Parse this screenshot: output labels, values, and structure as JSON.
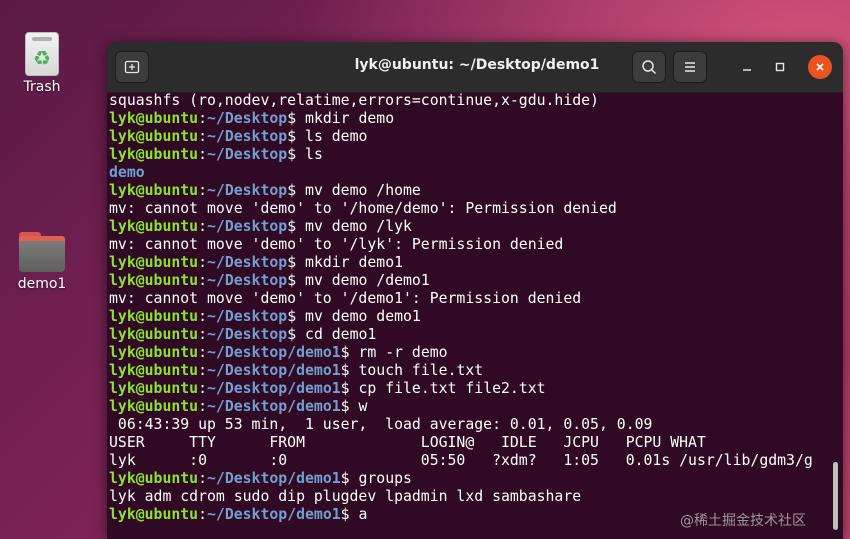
{
  "desktop": {
    "trash_label": "Trash",
    "folder_label": "demo1"
  },
  "window": {
    "title": "lyk@ubuntu: ~/Desktop/demo1",
    "icons": {
      "new_tab": "new-tab-icon",
      "search": "search-icon",
      "menu": "hamburger-menu-icon",
      "minimize": "minimize-icon",
      "maximize": "maximize-icon",
      "close": "close-icon"
    },
    "close_color": "#e95420"
  },
  "terminal": {
    "colors": {
      "background": "#300a24",
      "user": "#8ae234",
      "path": "#729fcf",
      "text": "#ffffff"
    },
    "lines": [
      {
        "type": "out",
        "text": "squashfs (ro,nodev,relatime,errors=continue,x-gdu.hide)"
      },
      {
        "type": "cmd",
        "user": "lyk@ubuntu",
        "path": "~/Desktop",
        "cmd": " mkdir demo"
      },
      {
        "type": "cmd",
        "user": "lyk@ubuntu",
        "path": "~/Desktop",
        "cmd": " ls demo"
      },
      {
        "type": "cmd",
        "user": "lyk@ubuntu",
        "path": "~/Desktop",
        "cmd": " ls"
      },
      {
        "type": "dir",
        "text": "demo"
      },
      {
        "type": "cmd",
        "user": "lyk@ubuntu",
        "path": "~/Desktop",
        "cmd": " mv demo /home"
      },
      {
        "type": "out",
        "text": "mv: cannot move 'demo' to '/home/demo': Permission denied"
      },
      {
        "type": "cmd",
        "user": "lyk@ubuntu",
        "path": "~/Desktop",
        "cmd": " mv demo /lyk"
      },
      {
        "type": "out",
        "text": "mv: cannot move 'demo' to '/lyk': Permission denied"
      },
      {
        "type": "cmd",
        "user": "lyk@ubuntu",
        "path": "~/Desktop",
        "cmd": " mkdir demo1"
      },
      {
        "type": "cmd",
        "user": "lyk@ubuntu",
        "path": "~/Desktop",
        "cmd": " mv demo /demo1"
      },
      {
        "type": "out",
        "text": "mv: cannot move 'demo' to '/demo1': Permission denied"
      },
      {
        "type": "cmd",
        "user": "lyk@ubuntu",
        "path": "~/Desktop",
        "cmd": " mv demo demo1"
      },
      {
        "type": "cmd",
        "user": "lyk@ubuntu",
        "path": "~/Desktop",
        "cmd": " cd demo1"
      },
      {
        "type": "cmd",
        "user": "lyk@ubuntu",
        "path": "~/Desktop/demo1",
        "cmd": " rm -r demo"
      },
      {
        "type": "cmd",
        "user": "lyk@ubuntu",
        "path": "~/Desktop/demo1",
        "cmd": " touch file.txt"
      },
      {
        "type": "cmd",
        "user": "lyk@ubuntu",
        "path": "~/Desktop/demo1",
        "cmd": " cp file.txt file2.txt"
      },
      {
        "type": "cmd",
        "user": "lyk@ubuntu",
        "path": "~/Desktop/demo1",
        "cmd": " w"
      },
      {
        "type": "out",
        "text": " 06:43:39 up 53 min,  1 user,  load average: 0.01, 0.05, 0.09"
      },
      {
        "type": "out",
        "text": "USER     TTY      FROM             LOGIN@   IDLE   JCPU   PCPU WHAT"
      },
      {
        "type": "out",
        "text": "lyk      :0       :0               05:50   ?xdm?   1:05   0.01s /usr/lib/gdm3/g"
      },
      {
        "type": "cmd",
        "user": "lyk@ubuntu",
        "path": "~/Desktop/demo1",
        "cmd": " groups"
      },
      {
        "type": "out",
        "text": "lyk adm cdrom sudo dip plugdev lpadmin lxd sambashare"
      },
      {
        "type": "cmd",
        "user": "lyk@ubuntu",
        "path": "~/Desktop/demo1",
        "cmd": " a"
      }
    ]
  },
  "watermark": "@稀土掘金技术社区"
}
